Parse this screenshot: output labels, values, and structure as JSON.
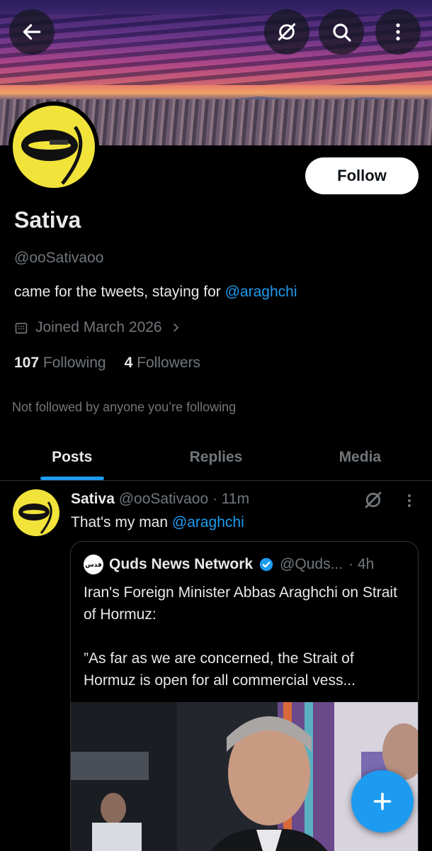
{
  "profile": {
    "display_name": "Sativa",
    "handle": "@ooSativaoo",
    "bio_text": "came for the tweets, staying for ",
    "bio_mention": "@araghchi",
    "joined": "Joined March 2026",
    "following_count": "107",
    "following_label": "Following",
    "followers_count": "4",
    "followers_label": "Followers",
    "not_followed": "Not followed by anyone you’re following",
    "follow_label": "Follow"
  },
  "tabs": [
    {
      "label": "Posts",
      "active": true
    },
    {
      "label": "Replies",
      "active": false
    },
    {
      "label": "Media",
      "active": false
    }
  ],
  "post": {
    "author": "Sativa",
    "handle": "@ooSativaoo",
    "time": "· 11m",
    "text": "That's my man ",
    "mention": "@araghchi",
    "quote": {
      "author": "Quds News Network",
      "logo_text": "قدس",
      "handle": "@Quds...",
      "time": "· 4h",
      "text": "Iran's Foreign Minister Abbas Araghchi on Strait of Hormuz:\n\n”As far as we are concerned, the Strait of Hormuz is open for all commercial vess..."
    }
  },
  "icons": {
    "back": "arrow-left-icon",
    "grok": "grok-icon",
    "search": "search-icon",
    "more": "more-vertical-icon",
    "calendar": "calendar-icon",
    "chevron": "chevron-right-icon",
    "verified": "verified-badge-icon",
    "compose": "plus-icon"
  },
  "colors": {
    "accent": "#1d9bf0",
    "text": "#e7e9ea",
    "muted": "#71767b",
    "background": "#000000"
  }
}
